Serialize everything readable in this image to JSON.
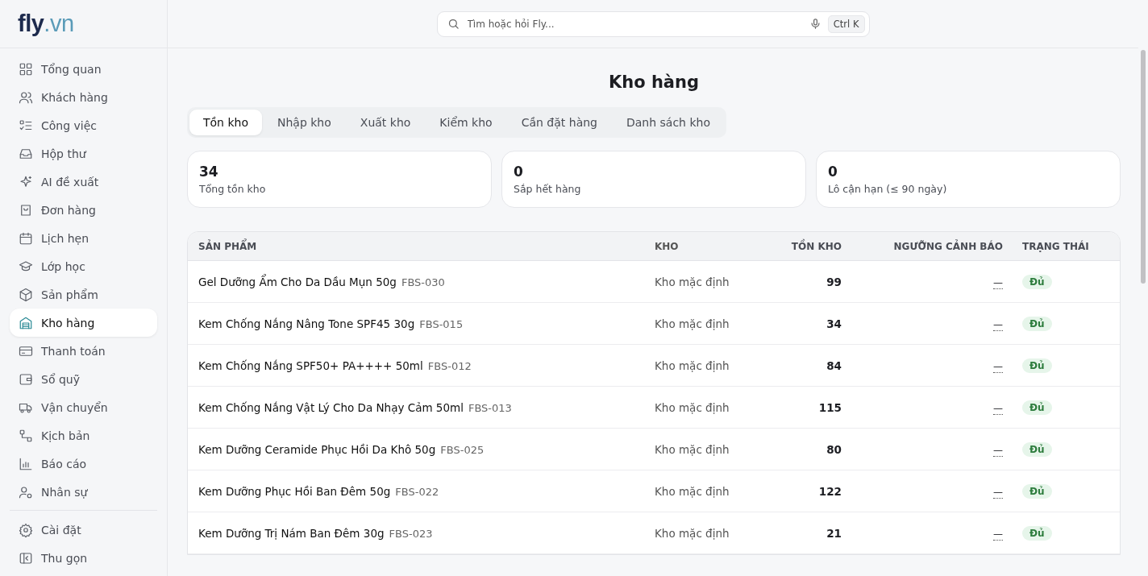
{
  "logo": {
    "main": "fly",
    "suffix": ".vn"
  },
  "sidebar": {
    "items": [
      {
        "label": "Tổng quan",
        "selected": false
      },
      {
        "label": "Khách hàng",
        "selected": false
      },
      {
        "label": "Công việc",
        "selected": false
      },
      {
        "label": "Hộp thư",
        "selected": false
      },
      {
        "label": "AI đề xuất",
        "selected": false
      },
      {
        "label": "Đơn hàng",
        "selected": false
      },
      {
        "label": "Lịch hẹn",
        "selected": false
      },
      {
        "label": "Lớp học",
        "selected": false
      },
      {
        "label": "Sản phẩm",
        "selected": false
      },
      {
        "label": "Kho hàng",
        "selected": true
      },
      {
        "label": "Thanh toán",
        "selected": false
      },
      {
        "label": "Sổ quỹ",
        "selected": false
      },
      {
        "label": "Vận chuyển",
        "selected": false
      },
      {
        "label": "Kịch bản",
        "selected": false
      },
      {
        "label": "Báo cáo",
        "selected": false
      },
      {
        "label": "Nhân sự",
        "selected": false
      }
    ],
    "footer_items": [
      {
        "label": "Cài đặt"
      },
      {
        "label": "Thu gọn"
      }
    ]
  },
  "search": {
    "placeholder": "Tìm hoặc hỏi Fly...",
    "shortcut": "Ctrl K"
  },
  "page_title": "Kho hàng",
  "tabs": [
    {
      "label": "Tồn kho",
      "selected": true
    },
    {
      "label": "Nhập kho",
      "selected": false
    },
    {
      "label": "Xuất kho",
      "selected": false
    },
    {
      "label": "Kiểm kho",
      "selected": false
    },
    {
      "label": "Cần đặt hàng",
      "selected": false
    },
    {
      "label": "Danh sách kho",
      "selected": false
    }
  ],
  "stats": [
    {
      "value": "34",
      "label": "Tổng tồn kho"
    },
    {
      "value": "0",
      "label": "Sắp hết hàng"
    },
    {
      "value": "0",
      "label": "Lô cận hạn (≤ 90 ngày)"
    }
  ],
  "table": {
    "columns": [
      "SẢN PHẨM",
      "KHO",
      "TỒN KHO",
      "NGƯỠNG CẢNH BÁO",
      "TRẠNG THÁI"
    ],
    "rows": [
      {
        "product": "Gel Dưỡng Ẩm Cho Da Dầu Mụn 50g",
        "sku": "FBS-030",
        "warehouse": "Kho mặc định",
        "stock": "99",
        "threshold": "—",
        "status": "Đủ"
      },
      {
        "product": "Kem Chống Nắng Nâng Tone SPF45 30g",
        "sku": "FBS-015",
        "warehouse": "Kho mặc định",
        "stock": "34",
        "threshold": "—",
        "status": "Đủ"
      },
      {
        "product": "Kem Chống Nắng SPF50+ PA++++ 50ml",
        "sku": "FBS-012",
        "warehouse": "Kho mặc định",
        "stock": "84",
        "threshold": "—",
        "status": "Đủ"
      },
      {
        "product": "Kem Chống Nắng Vật Lý Cho Da Nhạy Cảm 50ml",
        "sku": "FBS-013",
        "warehouse": "Kho mặc định",
        "stock": "115",
        "threshold": "—",
        "status": "Đủ"
      },
      {
        "product": "Kem Dưỡng Ceramide Phục Hồi Da Khô 50g",
        "sku": "FBS-025",
        "warehouse": "Kho mặc định",
        "stock": "80",
        "threshold": "—",
        "status": "Đủ"
      },
      {
        "product": "Kem Dưỡng Phục Hồi Ban Đêm 50g",
        "sku": "FBS-022",
        "warehouse": "Kho mặc định",
        "stock": "122",
        "threshold": "—",
        "status": "Đủ"
      },
      {
        "product": "Kem Dưỡng Trị Nám Ban Đêm 30g",
        "sku": "FBS-023",
        "warehouse": "Kho mặc định",
        "stock": "21",
        "threshold": "—",
        "status": "Đủ"
      }
    ]
  }
}
